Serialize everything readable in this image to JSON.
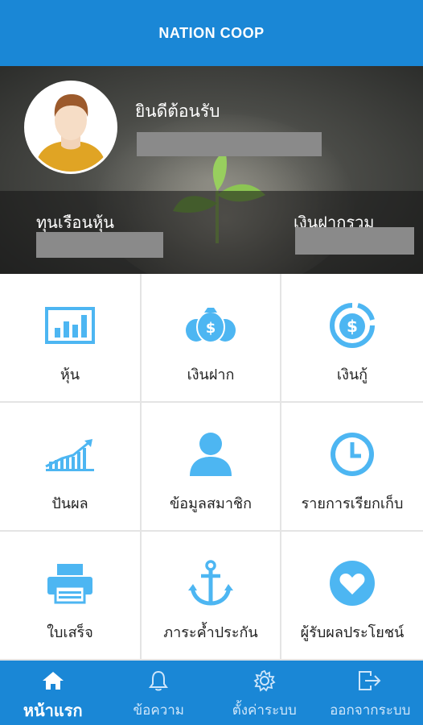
{
  "header": {
    "title": "NATION COOP"
  },
  "profile": {
    "welcome": "ยินดีต้อนรับ",
    "shares_label": "ทุนเรือนหุ้น",
    "deposit_label": "เงินฝากรวม"
  },
  "menu": [
    {
      "label": "หุ้น",
      "icon": "bar-chart-icon"
    },
    {
      "label": "เงินฝาก",
      "icon": "money-bags-icon"
    },
    {
      "label": "เงินกู้",
      "icon": "dollar-coin-icon"
    },
    {
      "label": "ปันผล",
      "icon": "growth-chart-icon"
    },
    {
      "label": "ข้อมูลสมาชิก",
      "icon": "person-icon"
    },
    {
      "label": "รายการเรียกเก็บ",
      "icon": "clock-icon"
    },
    {
      "label": "ใบเสร็จ",
      "icon": "printer-icon"
    },
    {
      "label": "ภาระค้ำประกัน",
      "icon": "anchor-icon"
    },
    {
      "label": "ผู้รับผลประโยชน์",
      "icon": "heart-icon"
    }
  ],
  "nav": [
    {
      "label": "หน้าแรก",
      "icon": "home-icon",
      "active": true
    },
    {
      "label": "ข้อความ",
      "icon": "bell-icon",
      "active": false
    },
    {
      "label": "ตั้งค่าระบบ",
      "icon": "gear-icon",
      "active": false
    },
    {
      "label": "ออกจากระบบ",
      "icon": "logout-icon",
      "active": false
    }
  ],
  "colors": {
    "primary": "#1a87d6",
    "icon": "#4db6f2",
    "nav_inactive": "#cfe6fa"
  }
}
